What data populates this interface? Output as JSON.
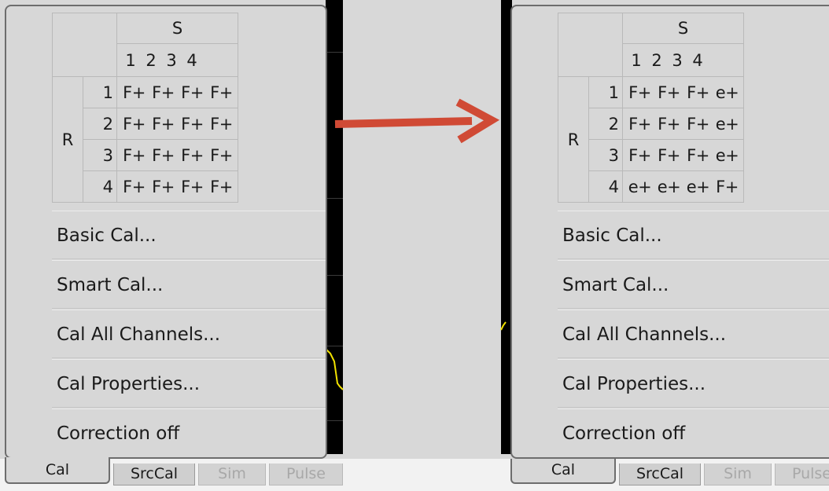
{
  "colors": {
    "arrow": "#d04a35",
    "trace": "#f2e200",
    "panel_bg": "#d7d7d7",
    "background": "#d8d8d8"
  },
  "before_panel": {
    "matrix": {
      "col_header": "S",
      "row_header": "R",
      "col_numbers": [
        "1",
        "2",
        "3",
        "4"
      ],
      "rows": [
        {
          "num": "1",
          "values": [
            "F+",
            "F+",
            "F+",
            "F+"
          ]
        },
        {
          "num": "2",
          "values": [
            "F+",
            "F+",
            "F+",
            "F+"
          ]
        },
        {
          "num": "3",
          "values": [
            "F+",
            "F+",
            "F+",
            "F+"
          ]
        },
        {
          "num": "4",
          "values": [
            "F+",
            "F+",
            "F+",
            "F+"
          ]
        }
      ]
    },
    "menu": {
      "basic_cal": "Basic Cal...",
      "smart_cal": "Smart Cal...",
      "cal_all_channels": "Cal All Channels...",
      "cal_properties": "Cal Properties...",
      "correction_off": "Correction off"
    },
    "tabs": {
      "cal": "Cal",
      "srccal": "SrcCal",
      "sim": "Sim",
      "pulse": "Pulse"
    }
  },
  "after_panel": {
    "matrix": {
      "col_header": "S",
      "row_header": "R",
      "col_numbers": [
        "1",
        "2",
        "3",
        "4"
      ],
      "rows": [
        {
          "num": "1",
          "values": [
            "F+",
            "F+",
            "F+",
            "e+"
          ]
        },
        {
          "num": "2",
          "values": [
            "F+",
            "F+",
            "F+",
            "e+"
          ]
        },
        {
          "num": "3",
          "values": [
            "F+",
            "F+",
            "F+",
            "e+"
          ]
        },
        {
          "num": "4",
          "values": [
            "e+",
            "e+",
            "e+",
            "F+"
          ]
        }
      ]
    },
    "menu": {
      "basic_cal": "Basic Cal...",
      "smart_cal": "Smart Cal...",
      "cal_all_channels": "Cal All Channels...",
      "cal_properties": "Cal Properties...",
      "correction_off": "Correction off"
    },
    "tabs": {
      "cal": "Cal",
      "srccal": "SrcCal",
      "sim": "Sim",
      "pulse": "Pulse"
    }
  }
}
